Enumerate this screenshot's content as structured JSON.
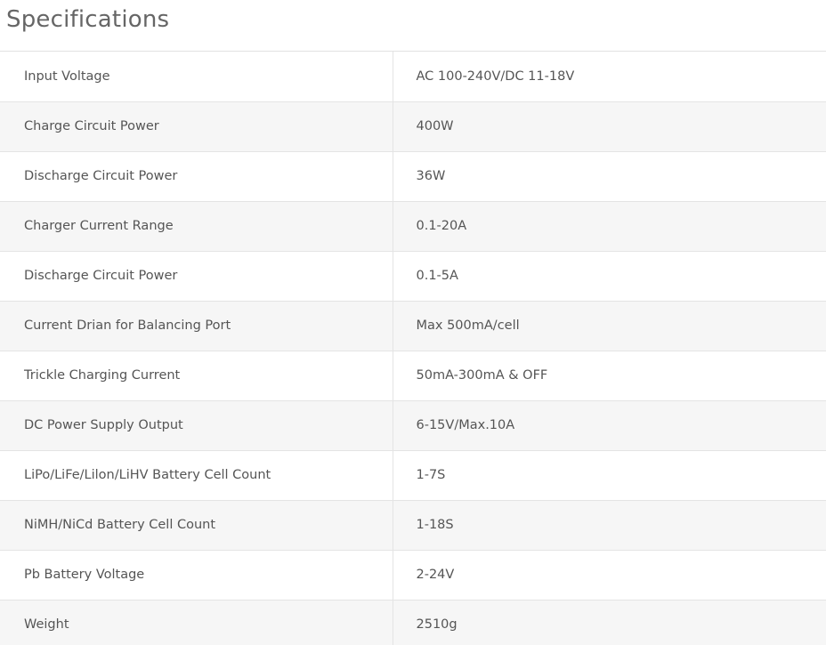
{
  "header": {
    "title": "Specifications"
  },
  "specs": [
    {
      "label": "Input Voltage",
      "value": "AC 100-240V/DC 11-18V"
    },
    {
      "label": "Charge Circuit Power",
      "value": "400W"
    },
    {
      "label": "Discharge Circuit Power",
      "value": "36W"
    },
    {
      "label": "Charger Current Range",
      "value": "0.1-20A"
    },
    {
      "label": "Discharge Circuit Power",
      "value": "0.1-5A"
    },
    {
      "label": "Current Drian for Balancing Port",
      "value": "Max 500mA/cell"
    },
    {
      "label": "Trickle Charging Current",
      "value": "50mA-300mA & OFF"
    },
    {
      "label": "DC Power Supply Output",
      "value": "6-15V/Max.10A"
    },
    {
      "label": "LiPo/LiFe/Lilon/LiHV Battery Cell Count",
      "value": "1-7S"
    },
    {
      "label": "NiMH/NiCd Battery Cell Count",
      "value": "1-18S"
    },
    {
      "label": "Pb Battery Voltage",
      "value": "2-24V"
    },
    {
      "label": "Weight",
      "value": "2510g"
    }
  ]
}
